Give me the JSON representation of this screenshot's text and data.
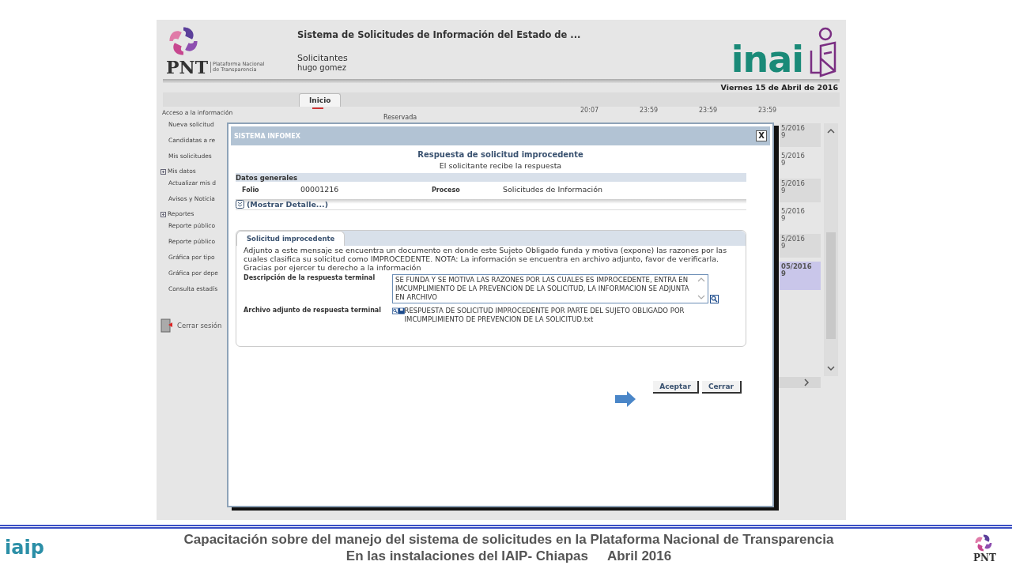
{
  "header": {
    "pnt_logo": "PNT",
    "pnt_logo_caption": "Plataforma Nacional de Transparencia",
    "title": "Sistema de Solicitudes de Información del Estado de ...",
    "role": "Solicitantes",
    "user": "hugo gomez",
    "inai_logo": "inai",
    "date": "Viernes 15 de Abril de 2016"
  },
  "tabs": [
    {
      "label": "Inicio",
      "selected": true
    }
  ],
  "sidebar": {
    "sections": [
      {
        "label": "Acceso a la información",
        "items": [
          "Nueva solicitud",
          "Candidatas a re",
          "Mis solicitudes"
        ]
      },
      {
        "label": "Mis datos",
        "items": [
          "Actualizar mis d",
          "Avisos y Noticia"
        ]
      },
      {
        "label": "Reportes",
        "items": [
          "Reporte público",
          "Reporte público",
          "Gráfica por tipo",
          "Gráfica por depe",
          "Consulta estadís"
        ]
      }
    ],
    "logout": "Cerrar sesión"
  },
  "table": {
    "times": [
      "20:07",
      "23:59",
      "23:59",
      "23:59"
    ],
    "status": "Reservada",
    "dates": [
      {
        "date": "5/2016",
        "time": "9",
        "selected": false
      },
      {
        "date": "5/2016",
        "time": "9",
        "selected": false
      },
      {
        "date": "5/2016",
        "time": "9",
        "selected": false
      },
      {
        "date": "5/2016",
        "time": "9",
        "selected": false
      },
      {
        "date": "5/2016",
        "time": "9",
        "selected": false
      },
      {
        "date": "05/2016",
        "time": "9",
        "selected": true
      }
    ]
  },
  "dialog": {
    "title": "SISTEMA INFOMEX",
    "close": "X",
    "heading": "Respuesta de solicitud improcedente",
    "subheading": "El solicitante recibe la respuesta",
    "section": "Datos generales",
    "fields": [
      {
        "label": "Folio",
        "value": "00001216"
      },
      {
        "label": "Proceso",
        "value": "Solicitudes de Información"
      }
    ],
    "details_link": "(Mostrar Detalle...)",
    "tab": {
      "label": "Solicitud improcedente",
      "selected": true
    },
    "message": "Adjunto a este mensaje se encuentra un documento en donde este Sujeto Obligado funda y motiva (expone) las razones por las cuales clasifica su solicitud como IMPROCEDENTE. NOTA: La información se encuentra en archivo adjunto, favor de verificarla.",
    "thanks": "Gracias por ejercer tu derecho a la información",
    "description_label": "Descripción de la respuesta terminal",
    "description": "SE FUNDA Y SE MOTIVA LAS RAZONES POR LAS CUALES ES IMPROCEDENTE, ENTRA EN IMCUMPLIMIENTO DE LA PREVENCION DE LA SOLICITUD, LA INFORMACION SE ADJUNTA EN ARCHIVO",
    "attachment_label": "Archivo adjunto de respuesta terminal",
    "attachment": "RESPUESTA DE SOLICITUD IMPROCEDENTE POR PARTE DEL SUJETO OBLIGADO POR IMCUMPLIMIENTO DE PREVENCION DE LA SOLICITUD.txt",
    "buttons": [
      "Aceptar",
      "Cerrar"
    ]
  },
  "footer": {
    "iaip_logo": "iaip",
    "line1": "Capacitación sobre del manejo del sistema de solicitudes en la Plataforma Nacional de Transparencia",
    "line2": "En las instalaciones del IAIP- Chiapas",
    "line2_date": "Abril 2016",
    "pnt_logo": "PNT"
  }
}
